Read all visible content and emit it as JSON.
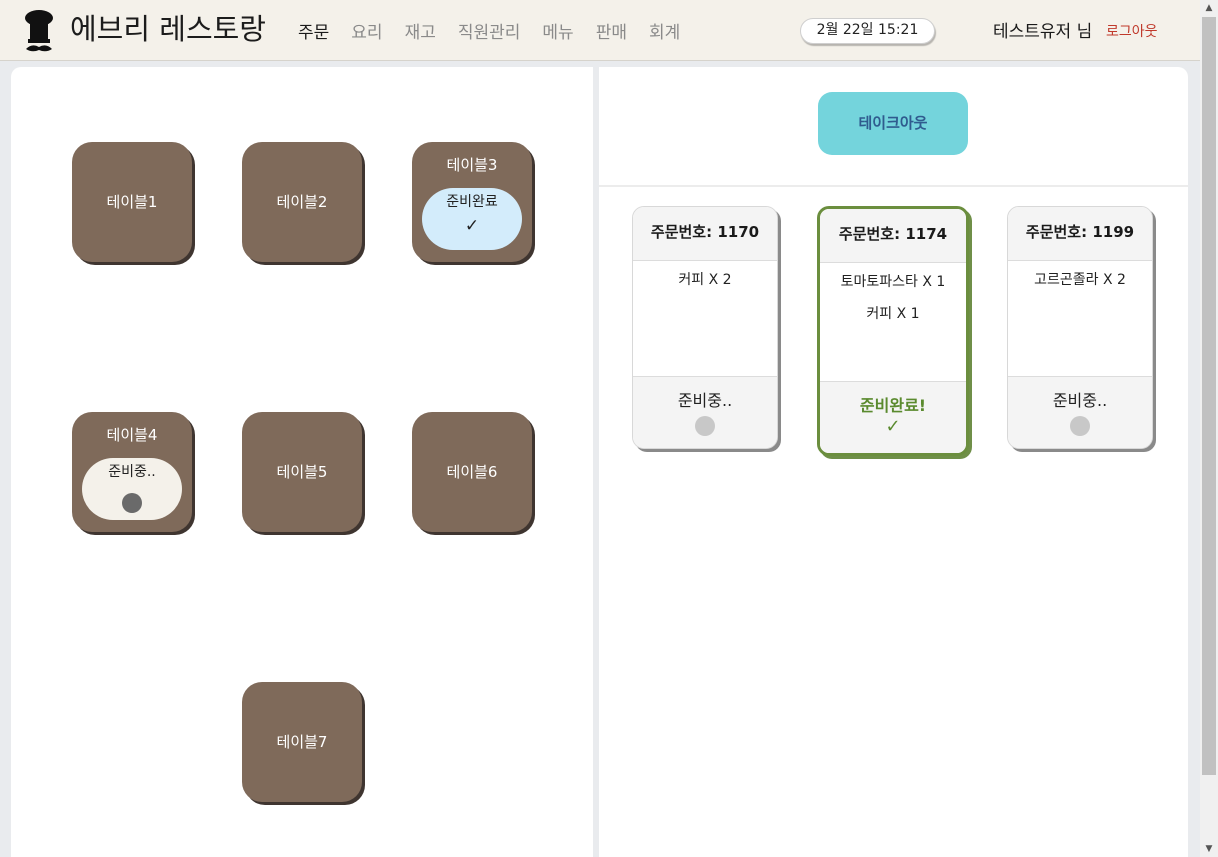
{
  "header": {
    "brand": "에브리 레스토랑",
    "nav": [
      {
        "label": "주문",
        "active": true
      },
      {
        "label": "요리",
        "active": false
      },
      {
        "label": "재고",
        "active": false
      },
      {
        "label": "직원관리",
        "active": false
      },
      {
        "label": "메뉴",
        "active": false
      },
      {
        "label": "판매",
        "active": false
      },
      {
        "label": "회계",
        "active": false
      }
    ],
    "datetime": "2월 22일 15:21",
    "user": "테스트유저 님",
    "logout": "로그아웃",
    "logo_icon": "chef-hat-icon"
  },
  "tables": [
    {
      "name": "테이블1",
      "status": null
    },
    {
      "name": "테이블2",
      "status": null
    },
    {
      "name": "테이블3",
      "status": {
        "type": "done",
        "label": "준비완료",
        "mark": "✓"
      }
    },
    {
      "name": "테이블4",
      "status": {
        "type": "prep",
        "label": "준비중..",
        "mark": ""
      }
    },
    {
      "name": "테이블5",
      "status": null
    },
    {
      "name": "테이블6",
      "status": null
    },
    {
      "name": "테이블7",
      "status": null
    }
  ],
  "takeout": {
    "label": "테이크아웃"
  },
  "orders": [
    {
      "number_label": "주문번호: 1170",
      "items": [
        "커피 X 2"
      ],
      "status": "준비중..",
      "ready": false
    },
    {
      "number_label": "주문번호: 1174",
      "items": [
        "토마토파스타 X 1",
        "커피 X 1"
      ],
      "status": "준비완료!",
      "ready": true,
      "mark": "✓"
    },
    {
      "number_label": "주문번호: 1199",
      "items": [
        "고르곤졸라 X 2"
      ],
      "status": "준비중..",
      "ready": false
    }
  ],
  "colors": {
    "header_bg": "#f4f1ea",
    "table_brown": "#7f6a5a",
    "takeout_cyan": "#74d4dc",
    "ready_green": "#6b8e3e",
    "logout_red": "#c0392b"
  }
}
